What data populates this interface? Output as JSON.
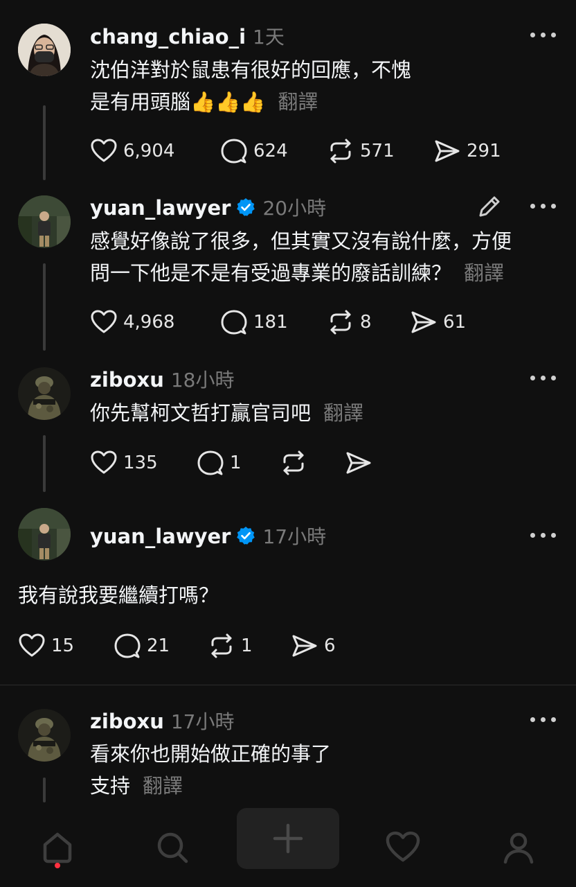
{
  "posts": [
    {
      "username": "chang_chiao_i",
      "time": "1天",
      "verified": false,
      "lines": [
        "沈伯洋對於鼠患有很好的回應，不愧",
        "是有用頭腦👍👍👍"
      ],
      "translate": "翻譯",
      "likes": "6,904",
      "replies": "624",
      "reposts": "571",
      "shares": "291"
    },
    {
      "username": "yuan_lawyer",
      "time": "20小時",
      "verified": true,
      "lines": [
        "感覺好像說了很多，但其實又沒有說什麼，方便",
        "問一下他是不是有受過專業的廢話訓練？"
      ],
      "translate": "翻譯",
      "likes": "4,968",
      "replies": "181",
      "reposts": "8",
      "shares": "61"
    },
    {
      "username": "ziboxu",
      "time": "18小時",
      "verified": false,
      "lines": [
        "你先幫柯文哲打贏官司吧"
      ],
      "translate": "翻譯",
      "likes": "135",
      "replies": "1"
    },
    {
      "username": "yuan_lawyer",
      "time": "17小時",
      "verified": true,
      "lines": [
        "我有說我要繼續打嗎？"
      ],
      "likes": "15",
      "replies": "21",
      "reposts": "1",
      "shares": "6"
    },
    {
      "username": "ziboxu",
      "time": "17小時",
      "verified": false,
      "lines": [
        "看來你也開始做正確的事了",
        "支持"
      ],
      "translate": "翻譯"
    }
  ],
  "nav": {
    "icons": [
      "home-icon",
      "search-icon",
      "create-icon",
      "activity-heart-icon",
      "profile-icon"
    ],
    "active": "home-icon",
    "notification_color": "#ff3040"
  },
  "colors": {
    "background": "#101010",
    "verified": "#0095f6",
    "muted": "#7a7a7a"
  }
}
